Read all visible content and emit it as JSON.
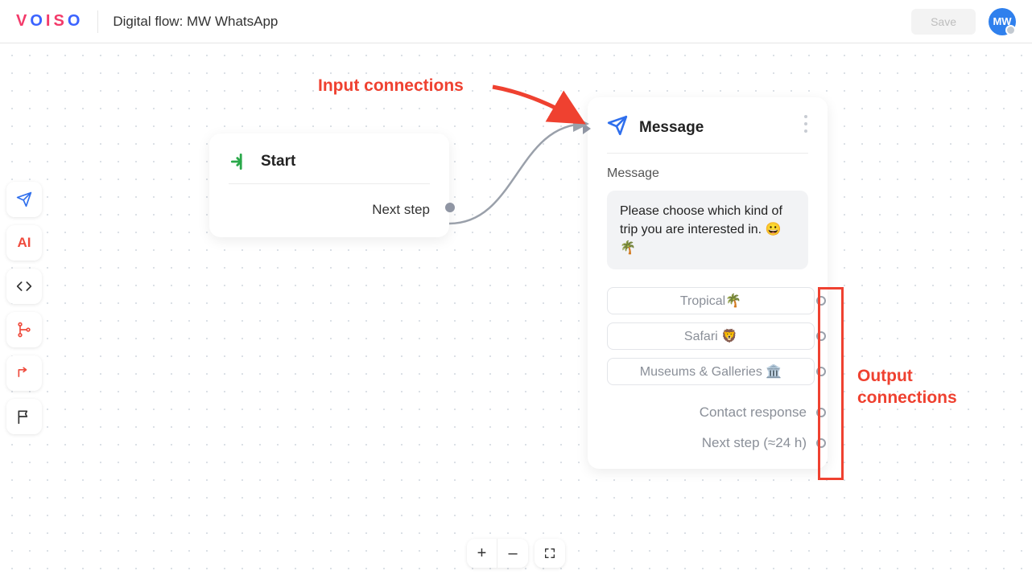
{
  "header": {
    "logo_text": "VOISO",
    "flow_title": "Digital flow: MW WhatsApp",
    "save_label": "Save",
    "avatar_initials": "MW"
  },
  "toolbar": {
    "items": [
      {
        "name": "message-tool"
      },
      {
        "name": "ai-tool",
        "label": "AI"
      },
      {
        "name": "code-tool"
      },
      {
        "name": "branch-tool"
      },
      {
        "name": "redirect-tool"
      },
      {
        "name": "flag-tool"
      }
    ]
  },
  "start_node": {
    "title": "Start",
    "next_label": "Next step"
  },
  "message_node": {
    "title": "Message",
    "section_label": "Message",
    "bubble_text": "Please choose which kind of trip you are interested in. 😀🌴",
    "options": [
      "Tropical🌴",
      "Safari 🦁",
      "Museums & Galleries 🏛️"
    ],
    "extra_outputs": [
      "Contact response",
      "Next step (≈24 h)"
    ]
  },
  "annotations": {
    "input_label": "Input connections",
    "output_label": "Output\nconnections"
  },
  "zoom": {
    "plus": "+",
    "minus": "–"
  }
}
